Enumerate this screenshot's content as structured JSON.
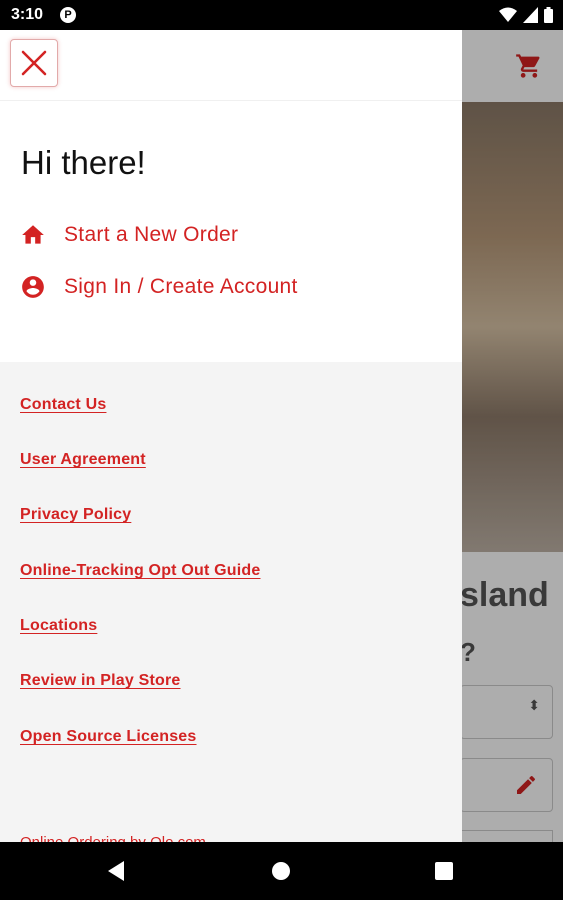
{
  "status_bar": {
    "time": "3:10",
    "notification_letter": "P"
  },
  "background": {
    "title_fragment": "sland",
    "question_fragment": "?",
    "select_arrows": "⬍"
  },
  "drawer": {
    "greeting": "Hi there!",
    "nav": [
      {
        "label": "Start a New Order",
        "icon": "home-icon"
      },
      {
        "label": "Sign In / Create Account",
        "icon": "account-circle-icon"
      }
    ],
    "links": [
      "Contact Us",
      "User Agreement",
      "Privacy Policy",
      "Online-Tracking Opt Out Guide",
      "Locations",
      "Review in Play Store",
      "Open Source Licenses"
    ],
    "footer": "Online Ordering by Olo.com"
  },
  "colors": {
    "accent": "#d32323",
    "drawer_bottom_bg": "#f4f4f4",
    "close_border": "#e2aaaa"
  }
}
